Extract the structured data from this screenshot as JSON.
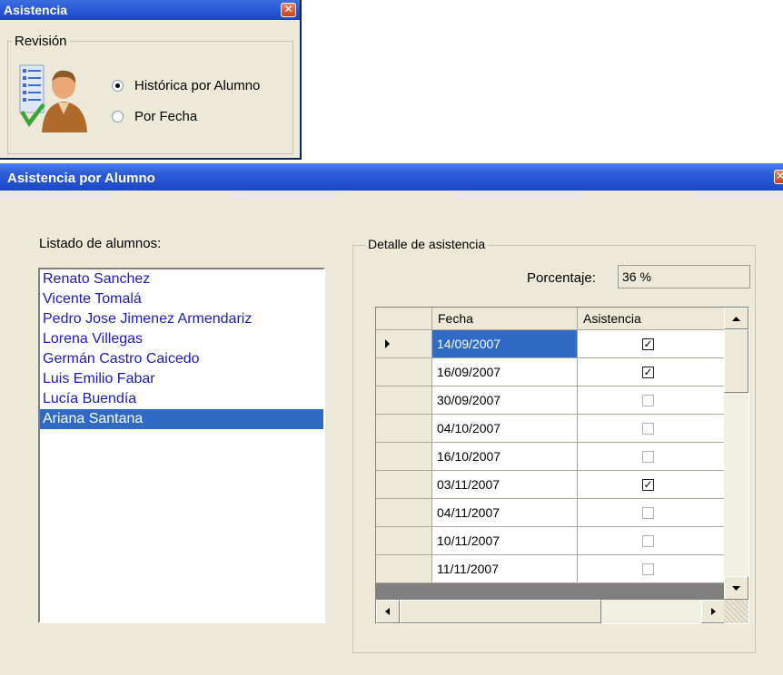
{
  "asistencia_window": {
    "title": "Asistencia",
    "close_glyph": "✕",
    "group_label": "Revisión",
    "icon": "student-attendance-icon",
    "options": [
      {
        "label": "Histórica por Alumno",
        "selected": true
      },
      {
        "label": "Por Fecha",
        "selected": false
      }
    ]
  },
  "alumno_window": {
    "title": "Asistencia por Alumno",
    "list_label": "Listado de alumnos:",
    "students": [
      "Renato Sanchez",
      "Vicente Tomalá",
      "Pedro Jose Jimenez Armendariz",
      "Lorena Villegas",
      "Germán Castro Caicedo",
      "Luis Emilio Fabar",
      "Lucía Buendía",
      "Ariana Santana"
    ],
    "selected_student_index": 7,
    "detail_label": "Detalle de asistencia",
    "percent_label": "Porcentaje:",
    "percent_value": "36 %",
    "grid": {
      "columns": [
        "Fecha",
        "Asistencia"
      ],
      "rows": [
        {
          "fecha": "14/09/2007",
          "asistencia": true
        },
        {
          "fecha": "16/09/2007",
          "asistencia": true
        },
        {
          "fecha": "30/09/2007",
          "asistencia": false
        },
        {
          "fecha": "04/10/2007",
          "asistencia": false
        },
        {
          "fecha": "16/10/2007",
          "asistencia": false
        },
        {
          "fecha": "03/11/2007",
          "asistencia": true
        },
        {
          "fecha": "04/11/2007",
          "asistencia": false
        },
        {
          "fecha": "10/11/2007",
          "asistencia": false
        },
        {
          "fecha": "11/11/2007",
          "asistencia": false
        }
      ],
      "current_row": 0
    }
  },
  "colors": {
    "titlebar": "#2b5bd8",
    "selection": "#316ac5",
    "list_text": "#1c1cb8",
    "face": "#ece9d8"
  }
}
